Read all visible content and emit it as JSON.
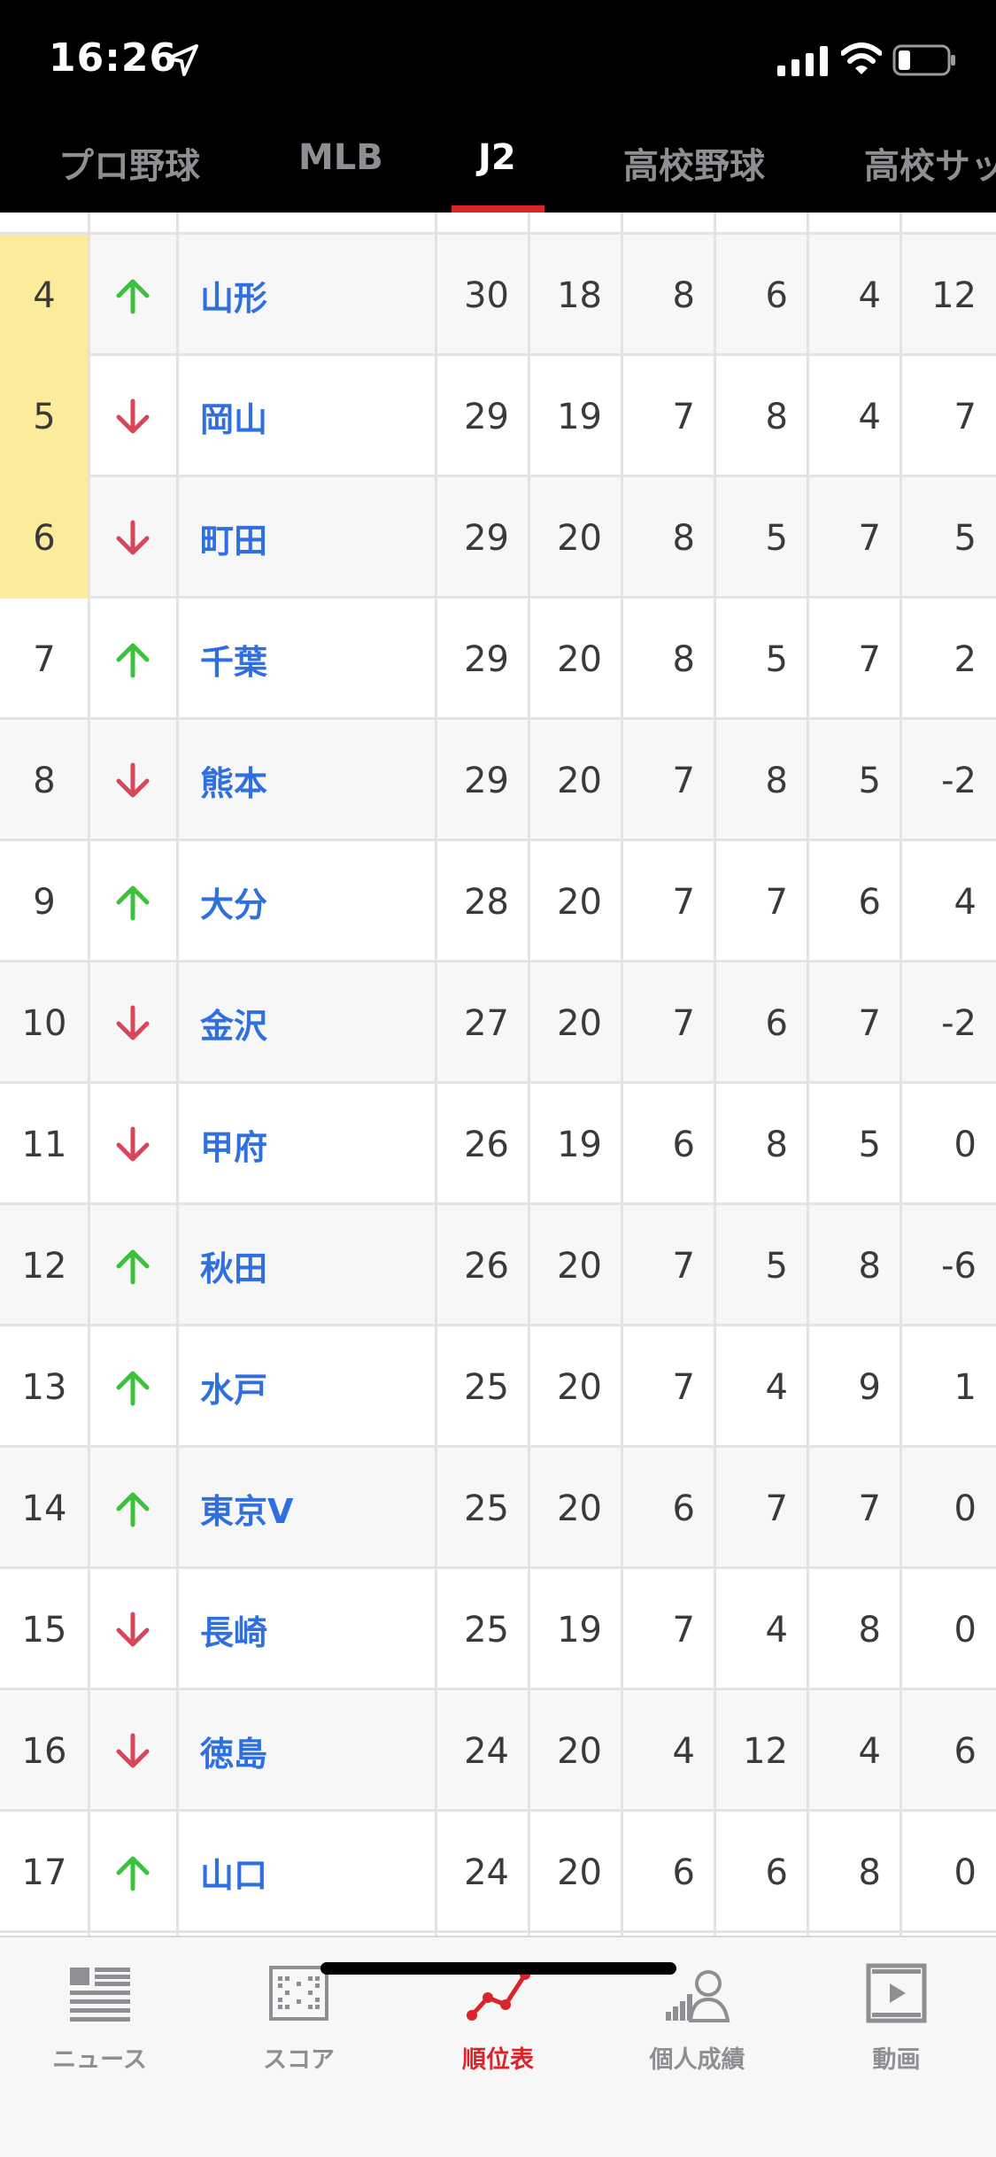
{
  "status_bar": {
    "time": "16:26"
  },
  "tabs": [
    {
      "label": "プロ野球",
      "active": false
    },
    {
      "label": "MLB",
      "active": false
    },
    {
      "label": "J2",
      "active": true
    },
    {
      "label": "高校野球",
      "active": false
    },
    {
      "label": "高校サッ",
      "active": false
    }
  ],
  "standings": {
    "rows": [
      {
        "rank": "4",
        "trend": "up",
        "team": "山形",
        "pts": "30",
        "played": "18",
        "won": "8",
        "drawn": "6",
        "lost": "4",
        "gd": "12",
        "playoff_zone": true
      },
      {
        "rank": "5",
        "trend": "down",
        "team": "岡山",
        "pts": "29",
        "played": "19",
        "won": "7",
        "drawn": "8",
        "lost": "4",
        "gd": "7",
        "playoff_zone": true
      },
      {
        "rank": "6",
        "trend": "down",
        "team": "町田",
        "pts": "29",
        "played": "20",
        "won": "8",
        "drawn": "5",
        "lost": "7",
        "gd": "5",
        "playoff_zone": true
      },
      {
        "rank": "7",
        "trend": "up",
        "team": "千葉",
        "pts": "29",
        "played": "20",
        "won": "8",
        "drawn": "5",
        "lost": "7",
        "gd": "2",
        "playoff_zone": false
      },
      {
        "rank": "8",
        "trend": "down",
        "team": "熊本",
        "pts": "29",
        "played": "20",
        "won": "7",
        "drawn": "8",
        "lost": "5",
        "gd": "-2",
        "playoff_zone": false
      },
      {
        "rank": "9",
        "trend": "up",
        "team": "大分",
        "pts": "28",
        "played": "20",
        "won": "7",
        "drawn": "7",
        "lost": "6",
        "gd": "4",
        "playoff_zone": false
      },
      {
        "rank": "10",
        "trend": "down",
        "team": "金沢",
        "pts": "27",
        "played": "20",
        "won": "7",
        "drawn": "6",
        "lost": "7",
        "gd": "-2",
        "playoff_zone": false
      },
      {
        "rank": "11",
        "trend": "down",
        "team": "甲府",
        "pts": "26",
        "played": "19",
        "won": "6",
        "drawn": "8",
        "lost": "5",
        "gd": "0",
        "playoff_zone": false
      },
      {
        "rank": "12",
        "trend": "up",
        "team": "秋田",
        "pts": "26",
        "played": "20",
        "won": "7",
        "drawn": "5",
        "lost": "8",
        "gd": "-6",
        "playoff_zone": false
      },
      {
        "rank": "13",
        "trend": "up",
        "team": "水戸",
        "pts": "25",
        "played": "20",
        "won": "7",
        "drawn": "4",
        "lost": "9",
        "gd": "1",
        "playoff_zone": false
      },
      {
        "rank": "14",
        "trend": "up",
        "team": "東京V",
        "pts": "25",
        "played": "20",
        "won": "6",
        "drawn": "7",
        "lost": "7",
        "gd": "0",
        "playoff_zone": false
      },
      {
        "rank": "15",
        "trend": "down",
        "team": "長崎",
        "pts": "25",
        "played": "19",
        "won": "7",
        "drawn": "4",
        "lost": "8",
        "gd": "0",
        "playoff_zone": false
      },
      {
        "rank": "16",
        "trend": "down",
        "team": "徳島",
        "pts": "24",
        "played": "20",
        "won": "4",
        "drawn": "12",
        "lost": "4",
        "gd": "6",
        "playoff_zone": false
      },
      {
        "rank": "17",
        "trend": "up",
        "team": "山口",
        "pts": "24",
        "played": "20",
        "won": "6",
        "drawn": "6",
        "lost": "8",
        "gd": "0",
        "playoff_zone": false
      }
    ]
  },
  "bottom_nav": [
    {
      "label": "ニュース",
      "icon": "news-icon",
      "active": false
    },
    {
      "label": "スコア",
      "icon": "scoreboard-icon",
      "active": false
    },
    {
      "label": "順位表",
      "icon": "standings-chart-icon",
      "active": true
    },
    {
      "label": "個人成績",
      "icon": "player-stats-icon",
      "active": false
    },
    {
      "label": "動画",
      "icon": "video-film-icon",
      "active": false
    }
  ],
  "colors": {
    "accent": "#d9242a",
    "team_link": "#2f6fe0",
    "trend_up": "#3cc13c",
    "trend_down": "#d6475a",
    "playoff_highlight": "#fbeb9a"
  }
}
